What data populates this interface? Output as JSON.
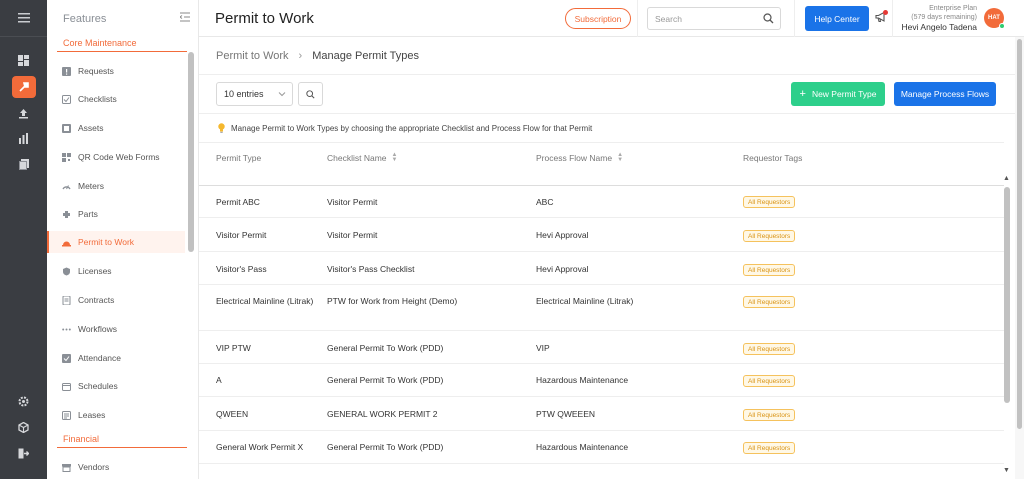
{
  "sidebar": {
    "title": "Features",
    "sections": [
      {
        "title": "Core Maintenance"
      },
      {
        "title": "Financial"
      }
    ],
    "items": [
      {
        "label": "Requests",
        "icon": "request-icon"
      },
      {
        "label": "Checklists",
        "icon": "checklist-icon"
      },
      {
        "label": "Assets",
        "icon": "asset-icon"
      },
      {
        "label": "QR Code Web Forms",
        "icon": "qr-icon"
      },
      {
        "label": "Meters",
        "icon": "meter-icon"
      },
      {
        "label": "Parts",
        "icon": "parts-icon"
      },
      {
        "label": "Permit to Work",
        "icon": "permit-icon",
        "active": true
      },
      {
        "label": "Licenses",
        "icon": "license-icon"
      },
      {
        "label": "Contracts",
        "icon": "contract-icon"
      },
      {
        "label": "Workflows",
        "icon": "workflow-icon"
      },
      {
        "label": "Attendance",
        "icon": "attendance-icon"
      },
      {
        "label": "Schedules",
        "icon": "schedule-icon"
      },
      {
        "label": "Leases",
        "icon": "lease-icon"
      },
      {
        "label": "Vendors",
        "icon": "vendor-icon"
      }
    ]
  },
  "header": {
    "title": "Permit to Work",
    "subscription_label": "Subscription",
    "search_placeholder": "Search",
    "help_label": "Help Center",
    "plan_line1": "Enterprise Plan",
    "plan_line2": "(579 days remaining)",
    "user_name": "Hevi Angelo Tadena",
    "avatar_initials": "HAT"
  },
  "breadcrumb": {
    "parent": "Permit to Work",
    "current": "Manage Permit Types"
  },
  "toolbar": {
    "entries_label": "10 entries",
    "new_label": "New Permit Type",
    "flows_label": "Manage Process Flows"
  },
  "tip": "Manage Permit to Work Types by choosing the appropriate Checklist and Process Flow for that Permit",
  "table": {
    "columns": [
      "Permit Type",
      "Checklist Name",
      "Process Flow Name",
      "Requestor Tags"
    ],
    "rows": [
      {
        "permit": "Permit ABC",
        "checklist": "Visitor Permit",
        "flow": "ABC",
        "tag": "All Requestors"
      },
      {
        "permit": "Visitor Permit",
        "checklist": "Visitor Permit",
        "flow": "Hevi Approval",
        "tag": "All Requestors"
      },
      {
        "permit": "Visitor's Pass",
        "checklist": "Visitor's Pass Checklist",
        "flow": "Hevi Approval",
        "tag": "All Requestors"
      },
      {
        "permit": "Electrical Mainline (Litrak)",
        "checklist": "PTW for Work from Height (Demo)",
        "flow": "Electrical Mainline (Litrak)",
        "tag": "All Requestors"
      },
      {
        "permit": "VIP PTW",
        "checklist": "General Permit To Work (PDD)",
        "flow": "VIP",
        "tag": "All Requestors"
      },
      {
        "permit": "A",
        "checklist": "General Permit To Work (PDD)",
        "flow": "Hazardous Maintenance",
        "tag": "All Requestors"
      },
      {
        "permit": "QWEEN",
        "checklist": "GENERAL WORK PERMIT 2",
        "flow": "PTW QWEEEN",
        "tag": "All Requestors"
      },
      {
        "permit": "General Work Permit X",
        "checklist": "General Permit To Work (PDD)",
        "flow": "Hazardous Maintenance",
        "tag": "All Requestors"
      }
    ]
  },
  "colors": {
    "accent": "#f26b3a",
    "primary": "#1a73e8",
    "success": "#2dcf8b",
    "rail": "#3a3d42"
  }
}
